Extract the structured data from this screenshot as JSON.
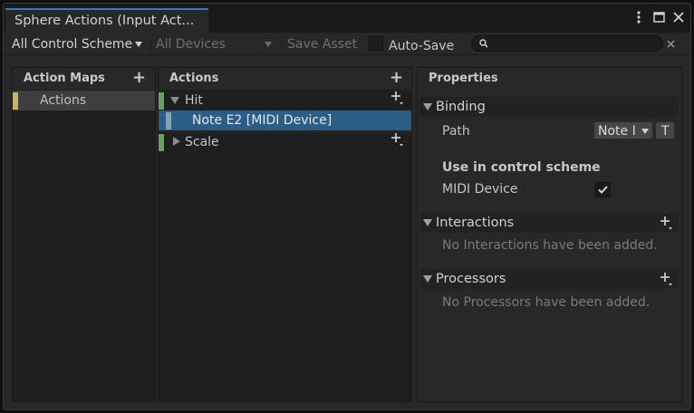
{
  "window": {
    "tab_title": "Sphere Actions (Input Act..."
  },
  "toolbar": {
    "control_scheme": "All Control Scheme",
    "devices": "All Devices",
    "save_asset": "Save Asset",
    "auto_save": "Auto-Save",
    "search_placeholder": ""
  },
  "action_maps": {
    "header": "Action Maps",
    "items": [
      {
        "label": "Actions",
        "color": "#c8b16d"
      }
    ]
  },
  "actions": {
    "header": "Actions",
    "items": [
      {
        "label": "Hit",
        "expanded": true,
        "color": "#6a9e63"
      },
      {
        "label": "Note E2 [MIDI Device]",
        "binding": true,
        "selected": true,
        "color": "#80a6b6"
      },
      {
        "label": "Scale",
        "expanded": false,
        "color": "#6a9e63"
      }
    ]
  },
  "properties": {
    "header": "Properties",
    "binding": {
      "title": "Binding",
      "path_label": "Path",
      "path_value": "Note I",
      "t_button": "T",
      "control_scheme_heading": "Use in control scheme",
      "scheme_name": "MIDI Device",
      "scheme_checked": true
    },
    "interactions": {
      "title": "Interactions",
      "empty": "No Interactions have been added."
    },
    "processors": {
      "title": "Processors",
      "empty": "No Processors have been added."
    }
  },
  "colors": {
    "accent": "#3a79bb",
    "selection": "#2c5d87"
  }
}
